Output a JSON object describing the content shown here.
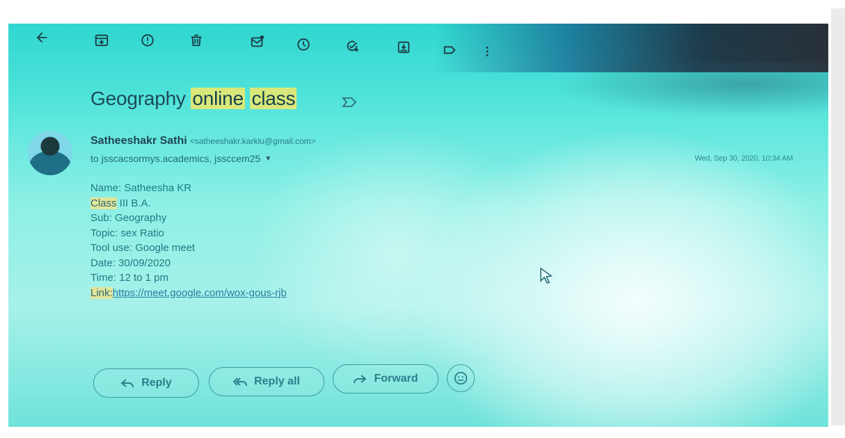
{
  "toolbar": {
    "icons": [
      "arrow-back-icon",
      "archive-icon",
      "report-spam-icon",
      "delete-icon",
      "mark-unread-icon",
      "snooze-icon",
      "add-task-icon",
      "move-to-icon",
      "label-icon",
      "more-vert-icon"
    ]
  },
  "email": {
    "subject_part1": "Geography ",
    "subject_part2": "online",
    "subject_part3": "class",
    "sender_name": "Satheeshakr Sathi",
    "sender_email": "<satheeshakr.karklu@gmail.com>",
    "recipients": "to jsscacsormys.academics, jssccem25",
    "date": "Wed, Sep 30, 2020, 10:34 AM",
    "body": {
      "name": "Name: Satheesha KR",
      "class_label": "Class",
      "class_value": " III B.A.",
      "sub": "Sub: Geography",
      "topic": "Topic: sex Ratio",
      "tool": "Tool use: Google meet",
      "date": "Date: 30/09/2020",
      "time": "Time: 12 to 1 pm",
      "link_label": "Link:",
      "link_url": "https://meet.google.com/wox-gous-rjb"
    }
  },
  "actions": {
    "reply": "Reply",
    "reply_all": "Reply all",
    "forward": "Forward"
  },
  "colors": {
    "highlight": "#d9e87a",
    "text_teal": "#1e7a83",
    "link": "#2a7fa0"
  }
}
